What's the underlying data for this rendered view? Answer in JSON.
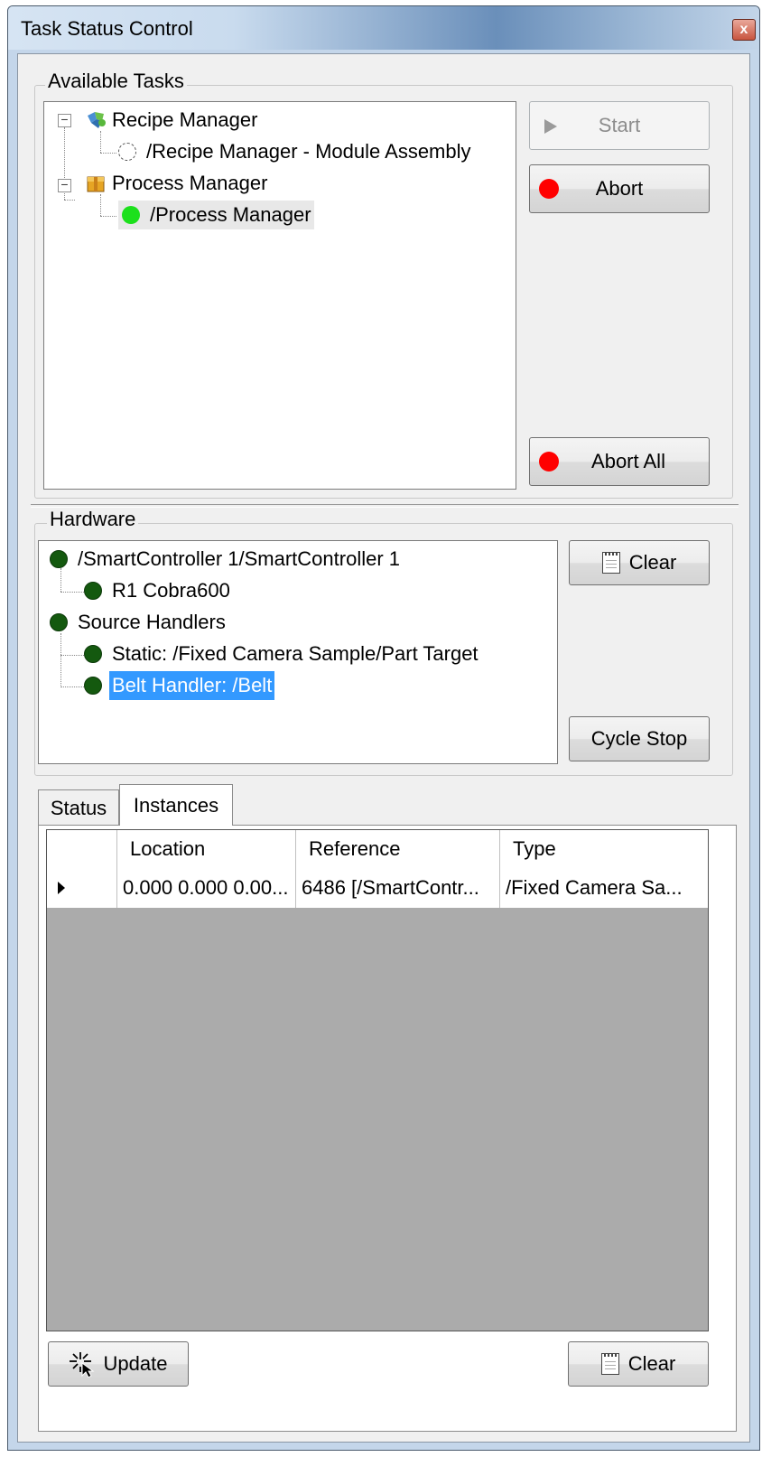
{
  "window": {
    "title": "Task Status Control",
    "close_label": "x"
  },
  "available_tasks": {
    "group_title": "Available Tasks",
    "tree": [
      {
        "label": "Recipe Manager",
        "icon": "recipe-manager-icon"
      },
      {
        "label": "/Recipe Manager - Module Assembly",
        "icon": "status-idle-icon"
      },
      {
        "label": "Process Manager",
        "icon": "process-manager-icon"
      },
      {
        "label": "/Process Manager",
        "icon": "status-running-icon"
      }
    ],
    "start_label": "Start",
    "abort_label": "Abort",
    "abort_all_label": "Abort All"
  },
  "hardware": {
    "group_title": "Hardware",
    "tree": [
      {
        "label": "/SmartController 1/SmartController 1"
      },
      {
        "label": "R1 Cobra600"
      },
      {
        "label": "Source Handlers"
      },
      {
        "label": "Static: /Fixed Camera Sample/Part Target"
      },
      {
        "label": "Belt Handler: /Belt"
      }
    ],
    "clear_label": "Clear",
    "cycle_stop_label": "Cycle Stop"
  },
  "tabs": {
    "status": "Status",
    "instances": "Instances"
  },
  "instances_grid": {
    "columns": [
      "Location",
      "Reference",
      "Type"
    ],
    "rows": [
      {
        "location": "0.000 0.000 0.00...",
        "reference": "6486 [/SmartContr...",
        "type": "/Fixed Camera Sa..."
      }
    ]
  },
  "bottom": {
    "update_label": "Update",
    "clear_label": "Clear"
  },
  "colors": {
    "status_dark_green": "#14590f",
    "status_bright_green": "#1ce01c",
    "abort_red": "#ff0000",
    "selection_blue": "#3399ff"
  }
}
